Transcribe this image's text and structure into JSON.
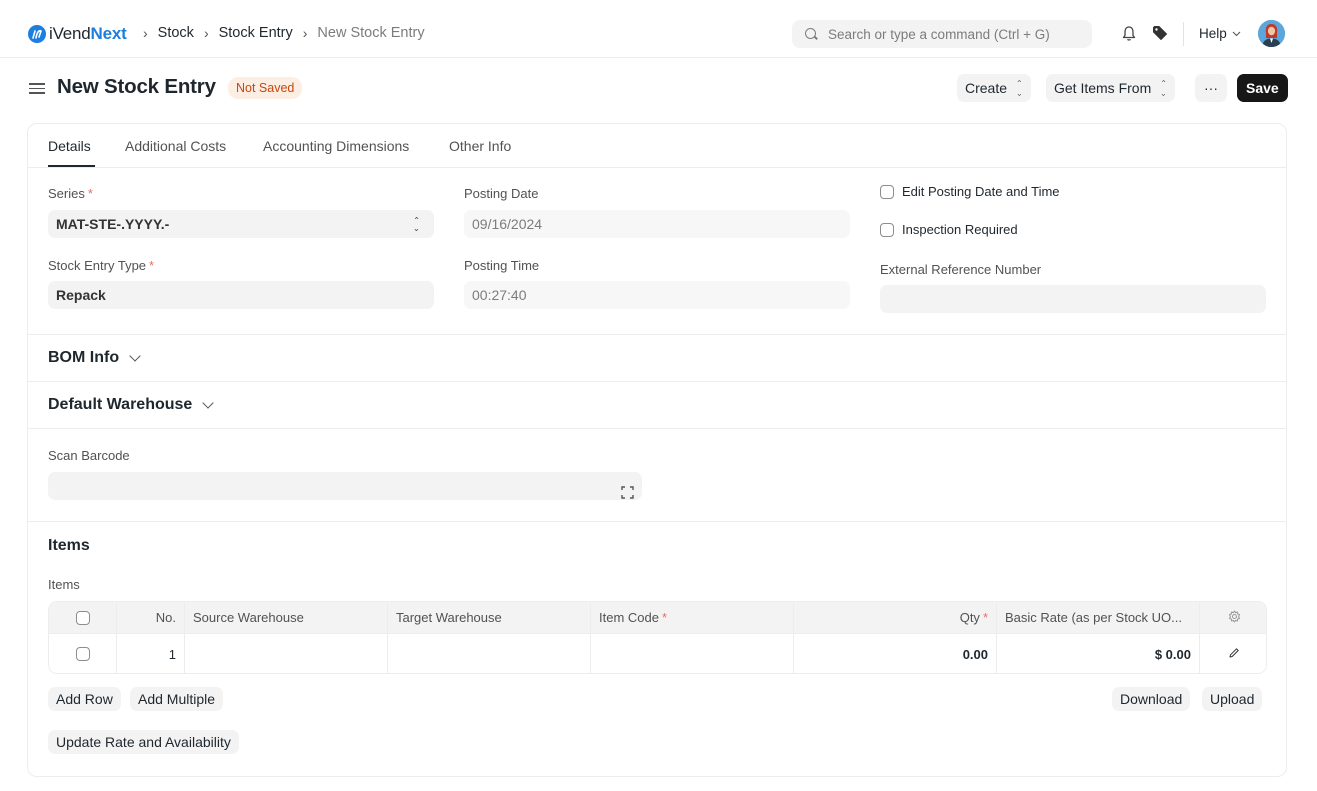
{
  "navbar": {
    "logo_mark": "iN",
    "logo_prefix": "iVend",
    "logo_suffix": "Next",
    "breadcrumbs": [
      {
        "label": "Stock"
      },
      {
        "label": "Stock Entry"
      },
      {
        "label": "New Stock Entry"
      }
    ],
    "breadcrumb_separator": "›",
    "search_placeholder": "Search or type a command (Ctrl + G)",
    "help_label": "Help",
    "colors": {
      "brand": "#1c7fe0"
    }
  },
  "page": {
    "title": "New Stock Entry",
    "status": "Not Saved",
    "actions": {
      "create": "Create",
      "get_items_from": "Get Items From",
      "more": "···",
      "save": "Save"
    }
  },
  "tabs": [
    {
      "label": "Details",
      "active": true
    },
    {
      "label": "Additional Costs",
      "active": false
    },
    {
      "label": "Accounting Dimensions",
      "active": false
    },
    {
      "label": "Other Info",
      "active": false
    }
  ],
  "details": {
    "series": {
      "label": "Series",
      "required": "*",
      "value": "MAT-STE-.YYYY.-"
    },
    "stock_entry_type": {
      "label": "Stock Entry Type",
      "required": "*",
      "value": "Repack"
    },
    "posting_date": {
      "label": "Posting Date",
      "value": "09/16/2024"
    },
    "posting_time": {
      "label": "Posting Time",
      "value": "00:27:40"
    },
    "edit_posting": {
      "label": "Edit Posting Date and Time",
      "checked": false
    },
    "inspection_required": {
      "label": "Inspection Required",
      "checked": false
    },
    "external_ref": {
      "label": "External Reference Number",
      "value": ""
    }
  },
  "sections": {
    "bom_info": "BOM Info",
    "default_warehouse": "Default Warehouse",
    "scan_barcode": {
      "label": "Scan Barcode",
      "value": ""
    },
    "items_heading": "Items"
  },
  "items_table": {
    "label": "Items",
    "columns": {
      "no": "No.",
      "source_warehouse": "Source Warehouse",
      "target_warehouse": "Target Warehouse",
      "item_code": "Item Code",
      "item_code_req": "*",
      "qty": "Qty",
      "qty_req": "*",
      "basic_rate": "Basic Rate (as per Stock UO..."
    },
    "rows": [
      {
        "no": "1",
        "source_warehouse": "",
        "target_warehouse": "",
        "item_code": "",
        "qty": "0.00",
        "basic_rate": "$ 0.00"
      }
    ],
    "buttons": {
      "add_row": "Add Row",
      "add_multiple": "Add Multiple",
      "download": "Download",
      "upload": "Upload",
      "update_rate": "Update Rate and Availability"
    }
  }
}
